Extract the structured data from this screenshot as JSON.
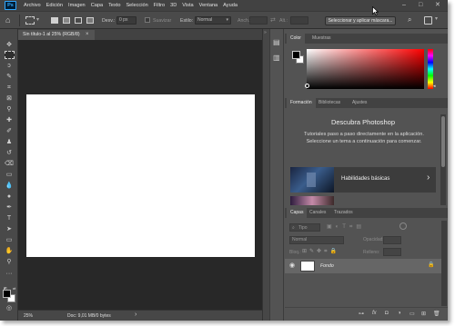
{
  "app": {
    "logo": "Ps",
    "menu": [
      "Archivo",
      "Edición",
      "Imagen",
      "Capa",
      "Texto",
      "Selección",
      "Filtro",
      "3D",
      "Vista",
      "Ventana",
      "Ayuda"
    ],
    "window_controls": {
      "minimize": "–",
      "maximize": "□",
      "close": "✕"
    }
  },
  "options": {
    "feather_label": "Desv.:",
    "feather_value": "0 px",
    "antialias_label": "Suavizar",
    "style_label": "Estilo:",
    "style_value": "Normal",
    "width_label": "Anch.:",
    "height_label": "Alt.:",
    "select_mask_label": "Seleccionar y aplicar máscara..."
  },
  "document": {
    "tab_title": "Sin título-1 al 25% (RGB/8)",
    "tab_close": "×",
    "zoom": "25%",
    "doc_info": "Doc: 9,01 MB/0 bytes",
    "status_arrow": "›"
  },
  "color_panel": {
    "tabs": [
      "Color",
      "Muestras"
    ],
    "foreground": "#000000",
    "background": "#ffffff",
    "hue": "#ff0000"
  },
  "learn_panel": {
    "tabs": [
      "Formación",
      "Bibliotecas",
      "Ajustes"
    ],
    "title": "Descubra Photoshop",
    "description": "Tutoriales paso a paso directamente en la aplicación. Seleccione un tema a continuación para comenzar.",
    "card_label": "Habilidades básicas",
    "card_arrow": "›"
  },
  "layers_panel": {
    "tabs": [
      "Capas",
      "Canales",
      "Trazados"
    ],
    "filter_placeholder": "Tipo",
    "blend_mode": "Normal",
    "opacity_label": "Opacidad:",
    "lock_label": "Bloq.:",
    "fill_label": "Relleno:",
    "layer_name": "Fondo"
  },
  "colors": {
    "accent": "#31a8ff",
    "panel_bg": "#535353",
    "dark_bg": "#282828"
  }
}
